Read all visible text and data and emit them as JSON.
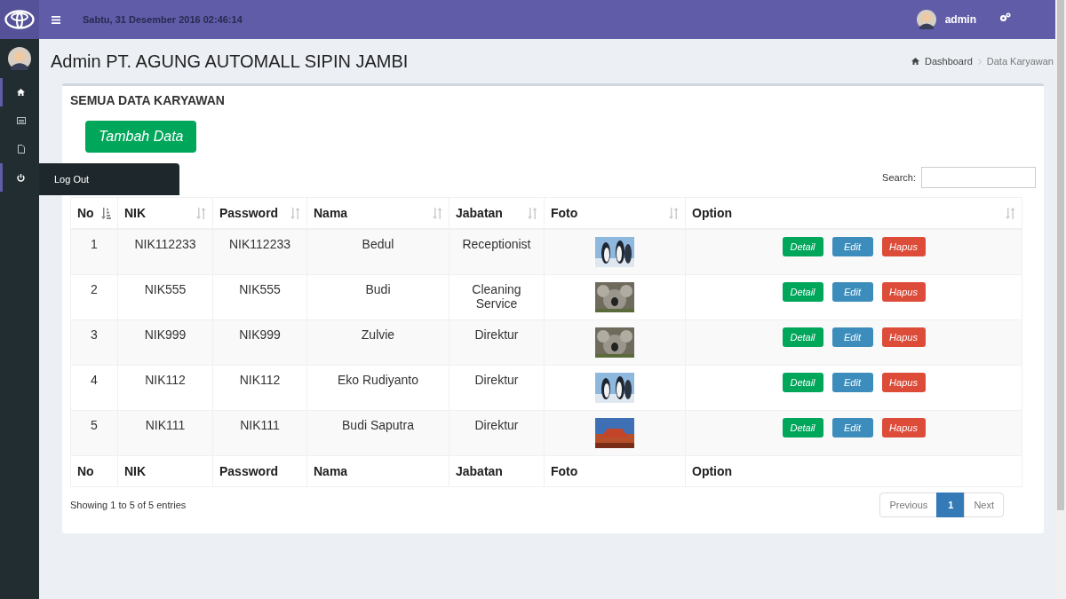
{
  "header": {
    "date": "Sabtu, 31 Desember 2016 02:46:14",
    "user": "admin"
  },
  "sidebar": {
    "items": [
      {
        "kind": "home",
        "selected": true
      },
      {
        "kind": "list",
        "selected": false
      },
      {
        "kind": "file",
        "selected": false
      },
      {
        "kind": "power",
        "selected": true,
        "tooltip": "Log Out"
      }
    ]
  },
  "page_title": "Admin PT. AGUNG AUTOMALL SIPIN JAMBI",
  "breadcrumb": [
    {
      "label": "Dashboard",
      "kind": "home"
    },
    {
      "label": "Data Karyawan",
      "kind": "current"
    }
  ],
  "box_title": "SEMUA DATA KARYAWAN",
  "add_button": "Tambah Data",
  "search": {
    "label": "Search:"
  },
  "table": {
    "columns": [
      {
        "label": "No",
        "sorted": true
      },
      {
        "label": "NIK",
        "sorted": false
      },
      {
        "label": "Password",
        "sorted": false
      },
      {
        "label": "Nama",
        "sorted": false
      },
      {
        "label": "Jabatan",
        "sorted": false
      },
      {
        "label": "Foto",
        "sorted": false
      },
      {
        "label": "Option",
        "sorted": false
      }
    ],
    "rows": [
      {
        "no": "1",
        "nik": "NIK112233",
        "password": "NIK112233",
        "nama": "Bedul",
        "jabatan": "Receptionist",
        "foto": {
          "kind": "picture"
        },
        "actions": [
          {
            "label": "Detail",
            "kind": "detail"
          },
          {
            "label": "Edit",
            "kind": "edit"
          },
          {
            "label": "Hapus",
            "kind": "delete"
          }
        ]
      },
      {
        "no": "2",
        "nik": "NIK555",
        "password": "NIK555",
        "nama": "Budi",
        "jabatan": "Cleaning Service",
        "foto": {
          "kind": "picture"
        },
        "actions": [
          {
            "label": "Detail",
            "kind": "detail"
          },
          {
            "label": "Edit",
            "kind": "edit"
          },
          {
            "label": "Hapus",
            "kind": "delete"
          }
        ]
      },
      {
        "no": "3",
        "nik": "NIK999",
        "password": "NIK999",
        "nama": "Zulvie",
        "jabatan": "Direktur",
        "foto": {
          "kind": "picture"
        },
        "actions": [
          {
            "label": "Detail",
            "kind": "detail"
          },
          {
            "label": "Edit",
            "kind": "edit"
          },
          {
            "label": "Hapus",
            "kind": "delete"
          }
        ]
      },
      {
        "no": "4",
        "nik": "NIK112",
        "password": "NIK112",
        "nama": "Eko Rudiyanto",
        "jabatan": "Direktur",
        "foto": {
          "kind": "picture"
        },
        "actions": [
          {
            "label": "Detail",
            "kind": "detail"
          },
          {
            "label": "Edit",
            "kind": "edit"
          },
          {
            "label": "Hapus",
            "kind": "delete"
          }
        ]
      },
      {
        "no": "5",
        "nik": "NIK111",
        "password": "NIK111",
        "nama": "Budi Saputra",
        "jabatan": "Direktur",
        "foto": {
          "kind": "picture"
        },
        "actions": [
          {
            "label": "Detail",
            "kind": "detail"
          },
          {
            "label": "Edit",
            "kind": "edit"
          },
          {
            "label": "Hapus",
            "kind": "delete"
          }
        ]
      }
    ],
    "footer": [
      "No",
      "NIK",
      "Password",
      "Nama",
      "Jabatan",
      "Foto",
      "Option"
    ]
  },
  "info": "Showing 1 to 5 of 5 entries",
  "pagination": [
    {
      "label": "Previous",
      "selected": false
    },
    {
      "label": "1",
      "selected": true
    },
    {
      "label": "Next",
      "selected": false
    }
  ]
}
